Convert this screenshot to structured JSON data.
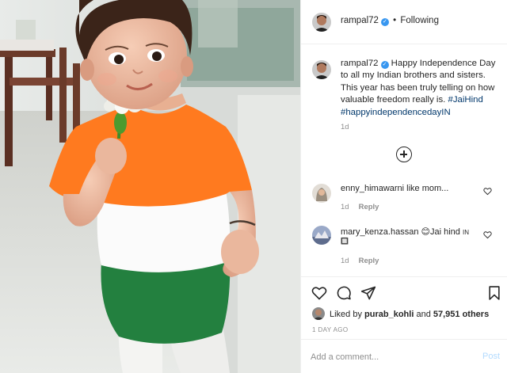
{
  "post": {
    "author": "rampal72",
    "author_verified": true,
    "follow_status": "Following",
    "separator": "•"
  },
  "caption": {
    "username": "rampal72",
    "text": "Happy Independence Day to all my Indian brothers and sisters. This year has been truly telling on how valuable freedom really is.",
    "hashtags": [
      "#JaiHind",
      "#happyindependencedayIN"
    ],
    "time": "1d"
  },
  "comments": [
    {
      "username": "enny_himawarni",
      "text": "like mom...",
      "time": "1d",
      "reply_label": "Reply"
    },
    {
      "username": "mary_kenza.hassan",
      "text": "😊Jai hind",
      "flag_line1": "IN",
      "flag_line2": "🔲",
      "time": "1d",
      "reply_label": "Reply"
    }
  ],
  "likes": {
    "prefix": "Liked by",
    "user": "purab_kohli",
    "conjunction": "and",
    "others": "57,951 others"
  },
  "date_label": "1 DAY AGO",
  "add_comment": {
    "placeholder": "Add a comment...",
    "post_label": "Post"
  },
  "icons": {
    "load_more": "plus-circle-icon",
    "like": "heart-icon",
    "comment": "comment-bubble-icon",
    "share": "paper-plane-icon",
    "save": "bookmark-icon",
    "verified": "verified-badge-icon"
  },
  "colors": {
    "verified_blue": "#3897f0",
    "hashtag": "#00376b",
    "muted": "#8e8e8e",
    "post_disabled": "#b3dbff",
    "saffron": "#ff7a1f",
    "green": "#23803f"
  }
}
